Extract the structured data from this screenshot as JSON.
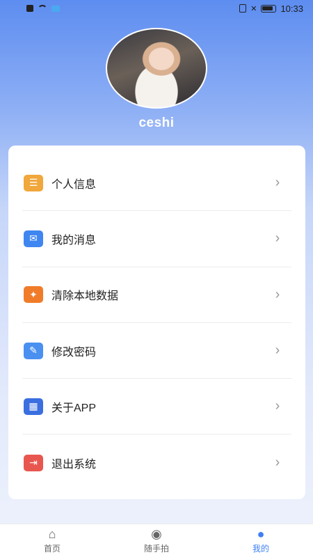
{
  "status_bar": {
    "time": "10:33",
    "icons": [
      "notification-icon",
      "wifi-icon",
      "app-icon",
      "vibrate-icon",
      "signal-off-icon",
      "battery-icon"
    ]
  },
  "profile": {
    "username": "ceshi"
  },
  "menu": {
    "items": [
      {
        "label": "个人信息",
        "icon": "person-info-icon",
        "color": "#f0a73c",
        "glyph": "☰"
      },
      {
        "label": "我的消息",
        "icon": "message-icon",
        "color": "#3f86f0",
        "glyph": "✉"
      },
      {
        "label": "清除本地数据",
        "icon": "broom-icon",
        "color": "#f07c2a",
        "glyph": "✦"
      },
      {
        "label": "修改密码",
        "icon": "edit-icon",
        "color": "#4a90f0",
        "glyph": "✎"
      },
      {
        "label": "关于APP",
        "icon": "apps-icon",
        "color": "#3b6fe0",
        "glyph": "▦"
      },
      {
        "label": "退出系统",
        "icon": "logout-icon",
        "color": "#e8574f",
        "glyph": "⇥"
      }
    ],
    "arrow": "›"
  },
  "tabbar": {
    "tabs": [
      {
        "label": "首页",
        "icon": "home-icon",
        "glyph": "⌂",
        "active": false
      },
      {
        "label": "随手拍",
        "icon": "camera-icon",
        "glyph": "◉",
        "active": false
      },
      {
        "label": "我的",
        "icon": "user-icon",
        "glyph": "●",
        "active": true
      }
    ]
  },
  "colors": {
    "accent": "#3d7ff5",
    "header_gradient_top": "#5d8df0"
  }
}
